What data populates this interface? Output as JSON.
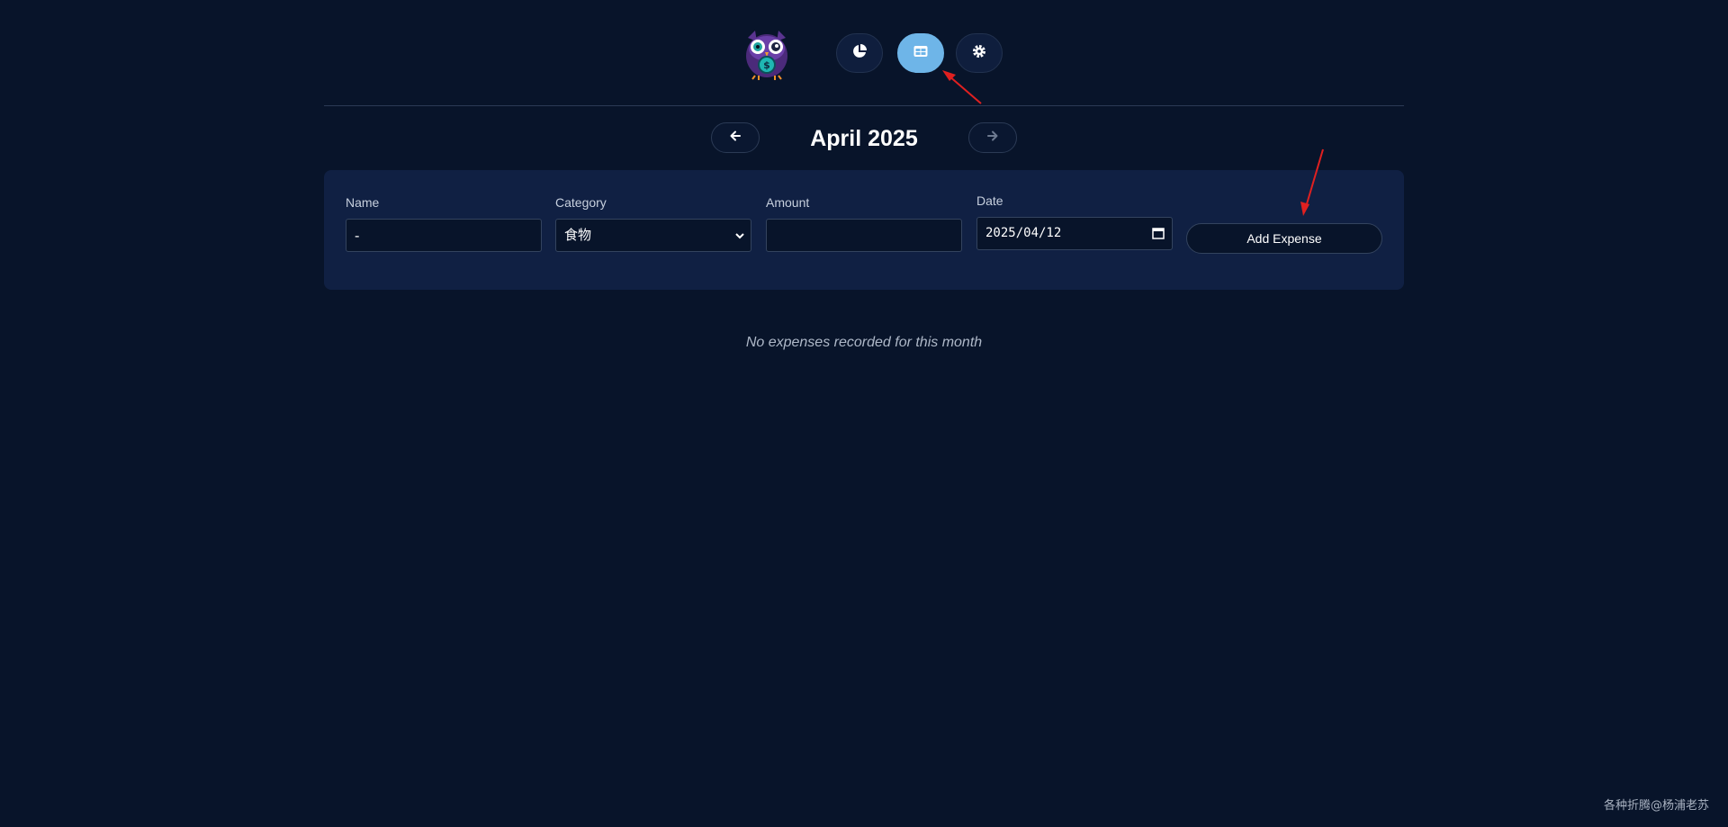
{
  "header": {
    "nav": [
      {
        "icon": "pie-chart-icon",
        "active": false
      },
      {
        "icon": "table-icon",
        "active": true
      },
      {
        "icon": "gear-icon",
        "active": false
      }
    ]
  },
  "month_nav": {
    "title": "April 2025"
  },
  "form": {
    "name_label": "Name",
    "name_value": "-",
    "category_label": "Category",
    "category_value": "食物",
    "amount_label": "Amount",
    "amount_value": "",
    "date_label": "Date",
    "date_value": "2025/04/12",
    "add_button": "Add Expense"
  },
  "empty_message": "No expenses recorded for this month",
  "watermark": "各种折腾@杨浦老苏",
  "colors": {
    "background": "#08142a",
    "card": "#102043",
    "active_nav": "#6eb5e8",
    "annotation_arrow": "#e02020"
  }
}
